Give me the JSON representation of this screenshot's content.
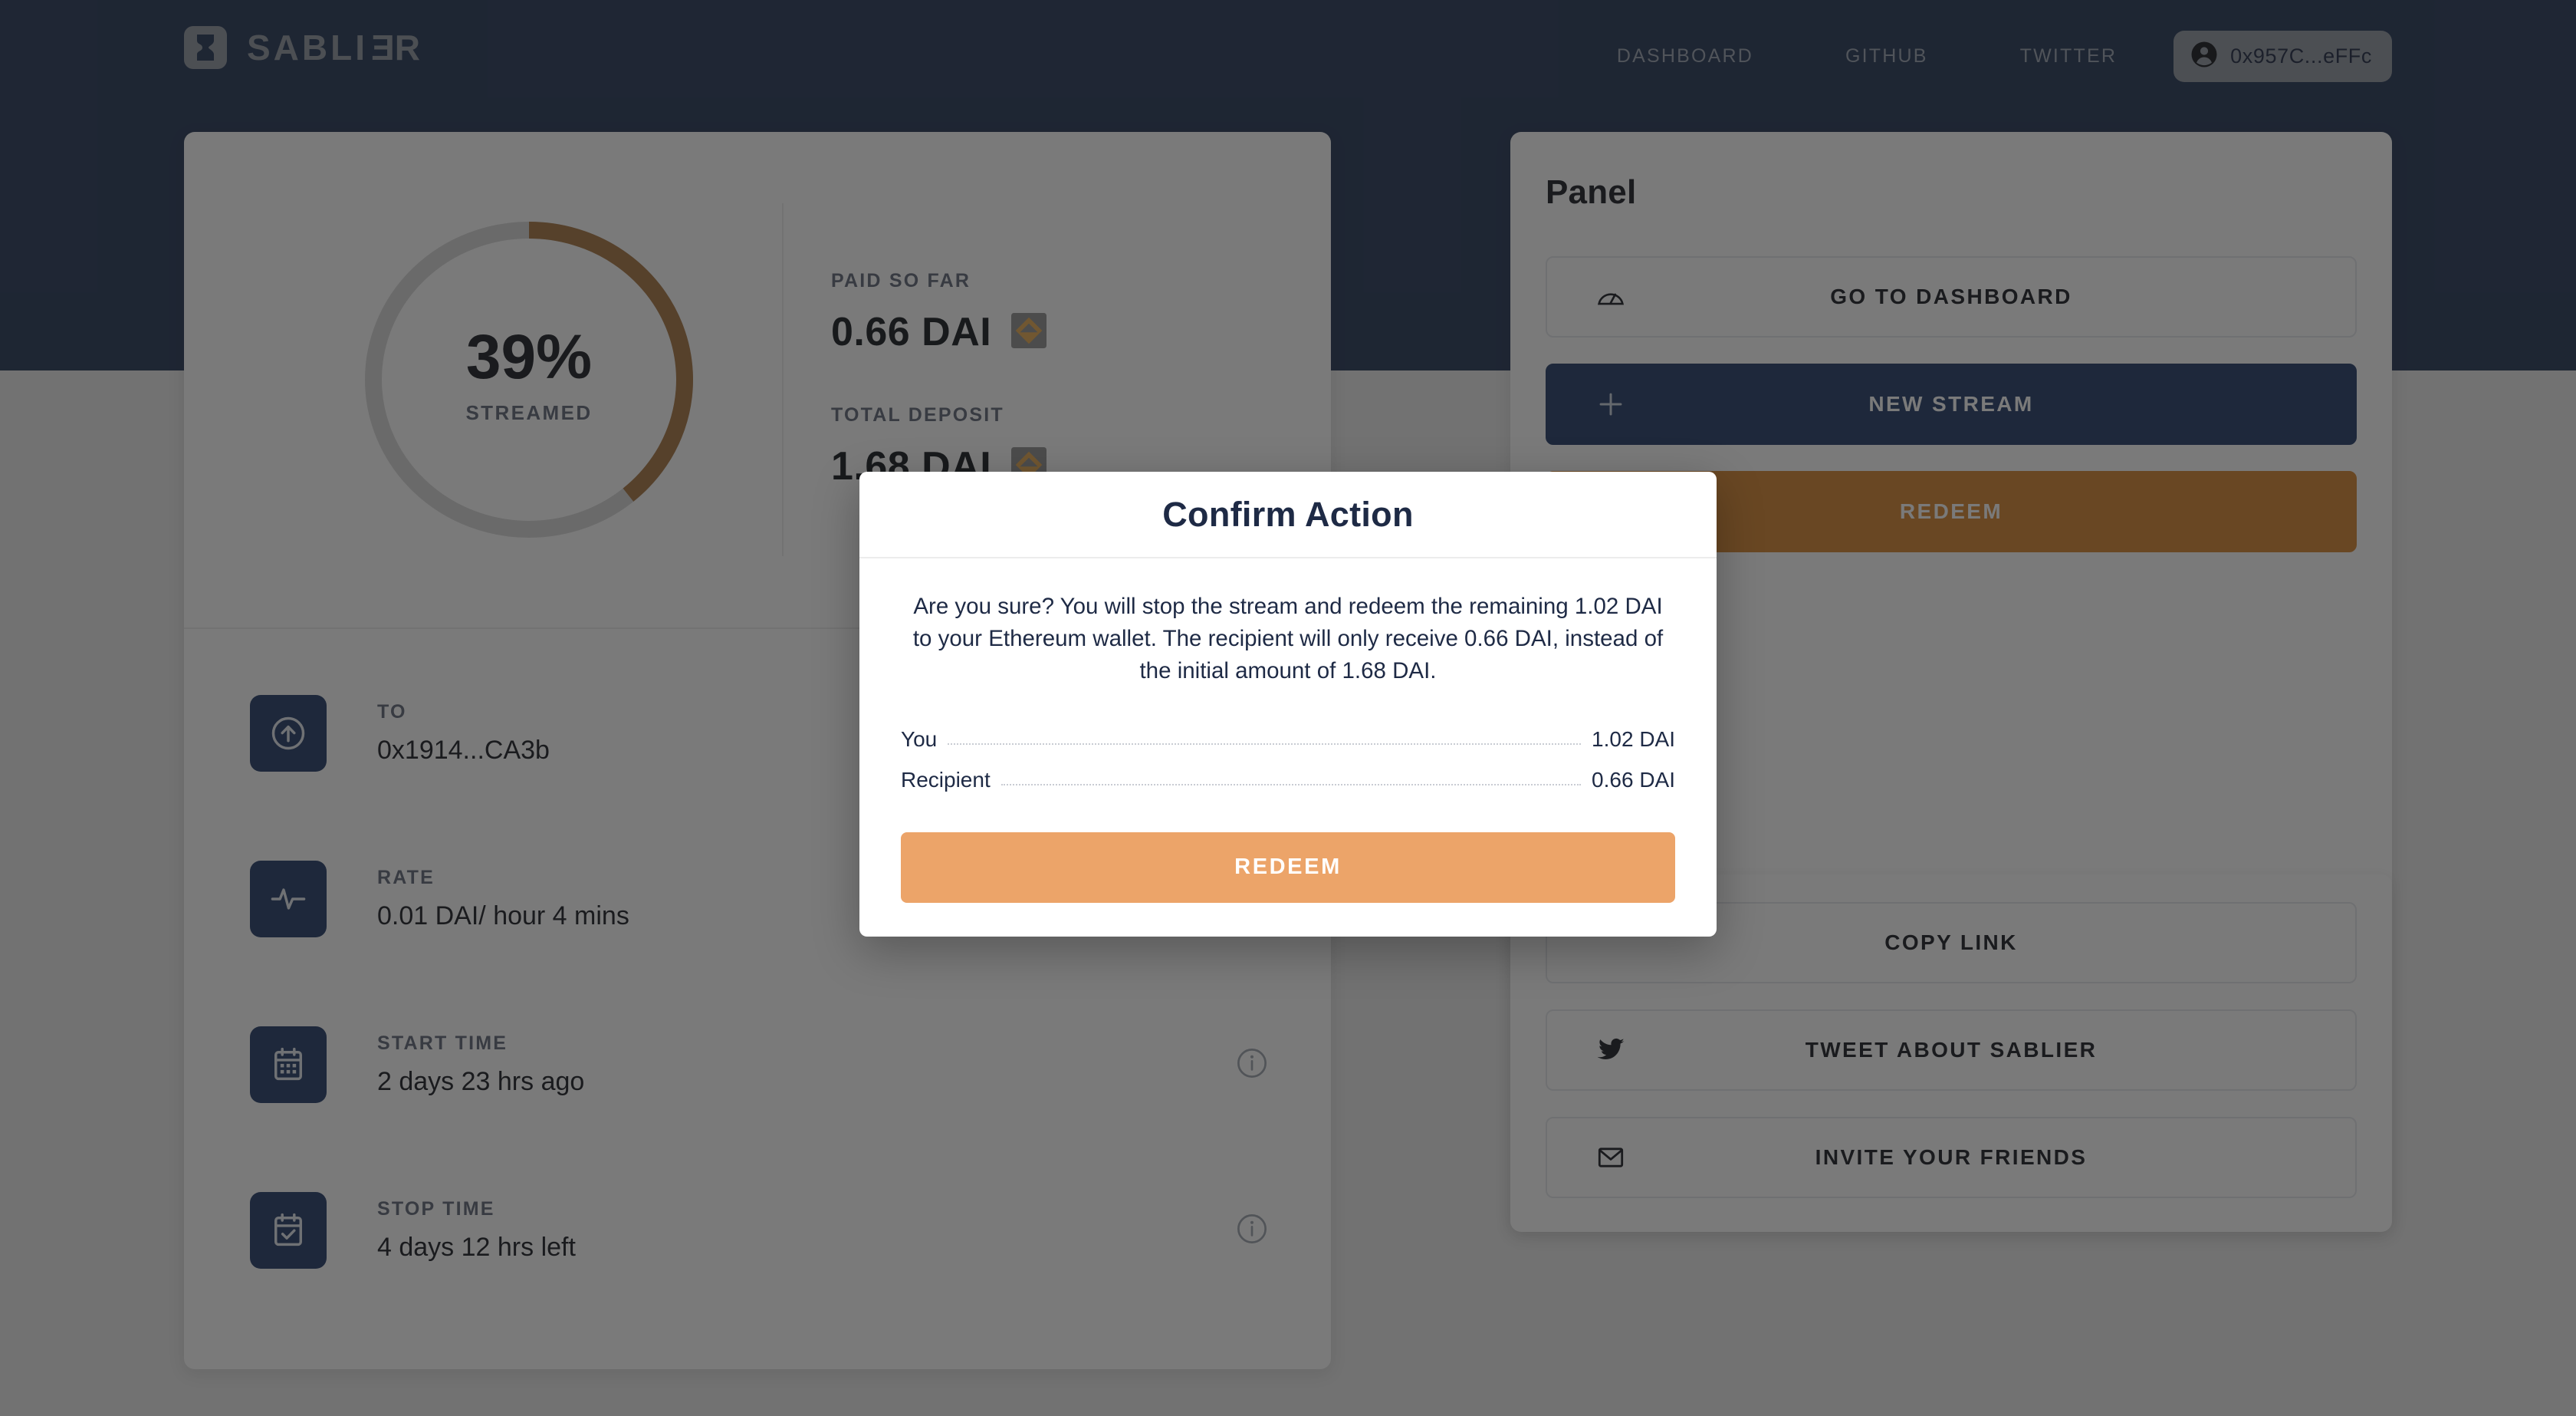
{
  "header": {
    "brand": {
      "name_prefix": "SABLI",
      "name_reversed": "E",
      "name_suffix": "R",
      "icon": "hourglass-icon"
    },
    "nav": [
      {
        "label": "DASHBOARD",
        "name": "nav-dashboard"
      },
      {
        "label": "GITHUB",
        "name": "nav-github"
      },
      {
        "label": "TWITTER",
        "name": "nav-twitter"
      }
    ],
    "account": {
      "address": "0x957C...eFFc",
      "icon": "account-circle-icon"
    }
  },
  "stream": {
    "progress": {
      "percent_label": "39%",
      "caption": "STREAMED",
      "percent_value": 39,
      "track_color": "#d8d8d8",
      "arc_color": "#a5703b"
    },
    "stats": [
      {
        "label": "PAID SO FAR",
        "value": "0.66 DAI",
        "token_icon": "dai-token-icon"
      },
      {
        "label": "TOTAL DEPOSIT",
        "value": "1.68 DAI",
        "token_icon": "dai-token-icon"
      }
    ],
    "rows": [
      {
        "label": "TO",
        "value": "0x1914...CA3b",
        "icon": "arrow-up-circle-icon",
        "info": false
      },
      {
        "label": "RATE",
        "value": "0.01 DAI/ hour 4 mins",
        "icon": "activity-pulse-icon",
        "info": false
      },
      {
        "label": "START TIME",
        "value": "2 days 23 hrs ago",
        "icon": "calendar-icon",
        "info": true
      },
      {
        "label": "STOP TIME",
        "value": "4 days 12 hrs left",
        "icon": "calendar-check-icon",
        "info": true
      }
    ]
  },
  "panel": {
    "title": "Panel",
    "actions": [
      {
        "label": "GO TO DASHBOARD",
        "icon": "speedometer-icon",
        "style": "outline"
      },
      {
        "label": "NEW STREAM",
        "icon": "plus-icon",
        "style": "primary"
      },
      {
        "label": "REDEEM",
        "icon": "",
        "style": "danger"
      }
    ]
  },
  "share": {
    "actions": [
      {
        "label": "COPY LINK",
        "icon": ""
      },
      {
        "label": "TWEET ABOUT SABLIER",
        "icon": "twitter-bird-icon"
      },
      {
        "label": "INVITE YOUR FRIENDS",
        "icon": "envelope-icon"
      }
    ]
  },
  "modal": {
    "title": "Confirm Action",
    "message": "Are you sure? You will stop the stream and redeem the remaining 1.02 DAI to your Ethereum wallet. The recipient will only receive 0.66 DAI, instead of the initial amount of 1.68 DAI.",
    "rows": [
      {
        "label": "You",
        "value": "1.02 DAI"
      },
      {
        "label": "Recipient",
        "value": "0.66 DAI"
      }
    ],
    "cta_label": "REDEEM",
    "cta_color": "#eca469"
  },
  "colors": {
    "header_navy": "#1b2d4f",
    "accent_navy": "#1b3461",
    "redeem_brown": "#d48027",
    "modal_orange": "#eca469"
  }
}
